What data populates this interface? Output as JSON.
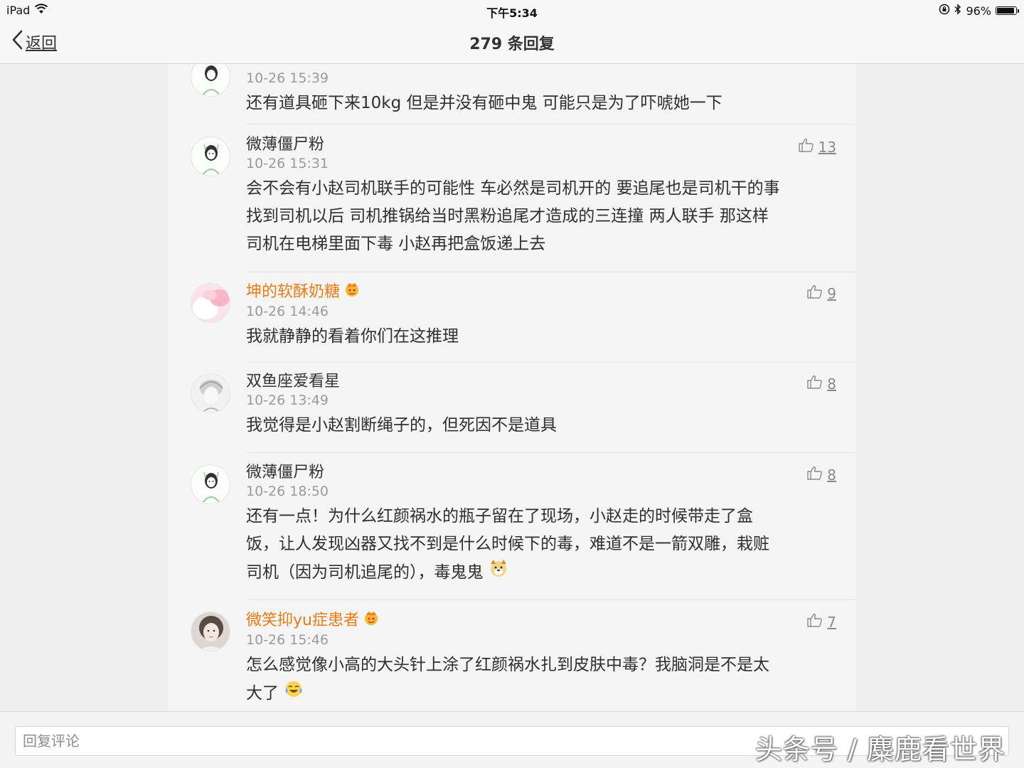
{
  "status_bar": {
    "device": "iPad",
    "time": "下午5:34",
    "battery": "96%",
    "battery_level": 0.96,
    "icons": [
      "wifi-icon",
      "orientation-lock-icon",
      "bluetooth-icon",
      "battery-icon"
    ]
  },
  "nav": {
    "back_label": "返回",
    "title": "279 条回复"
  },
  "comments": [
    {
      "username": "",
      "time": "10-26 15:39",
      "text": [
        "还有道具砸下来10kg 但是并没有砸中鬼 可能只是为了吓唬她一下"
      ],
      "likes": ""
    },
    {
      "username": "微薄僵尸粉",
      "time": "10-26 15:31",
      "text": [
        "会不会有小赵司机联手的可能性 车必然是司机开的 要追尾也是司机干的事",
        "找到司机以后 司机推锅给当时黑粉追尾才造成的三连撞 两人联手 那这样",
        "司机在电梯里面下毒 小赵再把盒饭递上去"
      ],
      "likes": "13"
    },
    {
      "username": "坤的软酥奶糖",
      "time": "10-26 14:46",
      "text": [
        "我就静静的看着你们在这推理"
      ],
      "likes": "9",
      "vip": true
    },
    {
      "username": "双鱼座爱看星",
      "time": "10-26 13:49",
      "text": [
        "我觉得是小赵割断绳子的，但死因不是道具"
      ],
      "likes": "8"
    },
    {
      "username": "微薄僵尸粉",
      "time": "10-26 18:50",
      "text": [
        "还有一点！为什么红颜祸水的瓶子留在了现场，小赵走的时候带走了盒",
        "饭，让人发现凶器又找不到是什么时候下的毒，难道不是一箭双雕，栽赃",
        "司机（因为司机追尾的），毒鬼鬼"
      ],
      "likes": "8",
      "emoji": "dog-emoji"
    },
    {
      "username": "微笑抑yu症患者",
      "time": "10-26 15:46",
      "text": [
        "怎么感觉像小高的大头针上涂了红颜祸水扎到皮肤中毒？我脑洞是不是太",
        "大了"
      ],
      "likes": "7",
      "vip": true,
      "emoji": "laugh-cry-emoji"
    }
  ],
  "reply": {
    "placeholder": "回复评论"
  },
  "watermark": "头条号 / 麋鹿看世界",
  "colors": {
    "vip_name": "#f07a12",
    "text": "#2f2f2f",
    "meta": "#9a9a9a",
    "page_bg": "#efefef",
    "panel_bg": "#f5f5f5"
  }
}
